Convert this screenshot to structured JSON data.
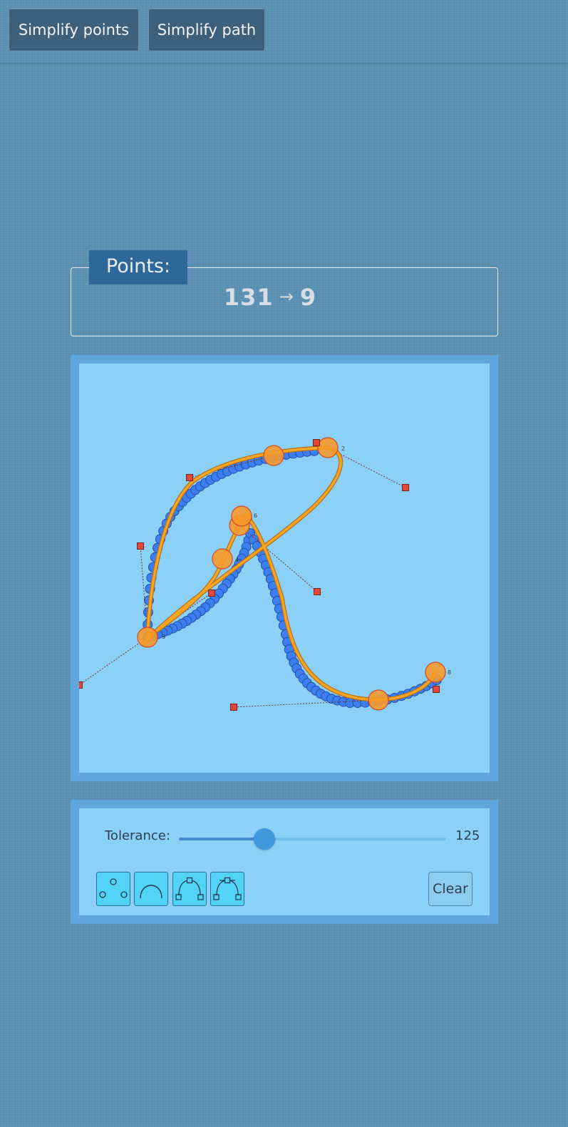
{
  "toolbar": {
    "simplify_points_label": "Simplify points",
    "simplify_path_label": "Simplify path"
  },
  "points": {
    "legend": "Points:",
    "original_count": "131",
    "arrow": "→",
    "simplified_count": "9"
  },
  "canvas": {
    "point_labels": [
      "2",
      "3",
      "4",
      "6",
      "8"
    ],
    "colors": {
      "background": "#8bd0f7",
      "input_point": "#3b7ff0",
      "path_stroke": "#f6a623",
      "anchor": "#f79a2b",
      "control_handle": "#e0483a"
    }
  },
  "controls": {
    "tolerance_label": "Tolerance:",
    "tolerance_value": "125",
    "tolerance_fraction": 0.32,
    "mode_buttons": [
      {
        "icon": "points-mode-icon"
      },
      {
        "icon": "arc-mode-icon"
      },
      {
        "icon": "bezier-mode-icon"
      },
      {
        "icon": "bezier-handles-mode-icon"
      }
    ],
    "clear_label": "Clear"
  }
}
